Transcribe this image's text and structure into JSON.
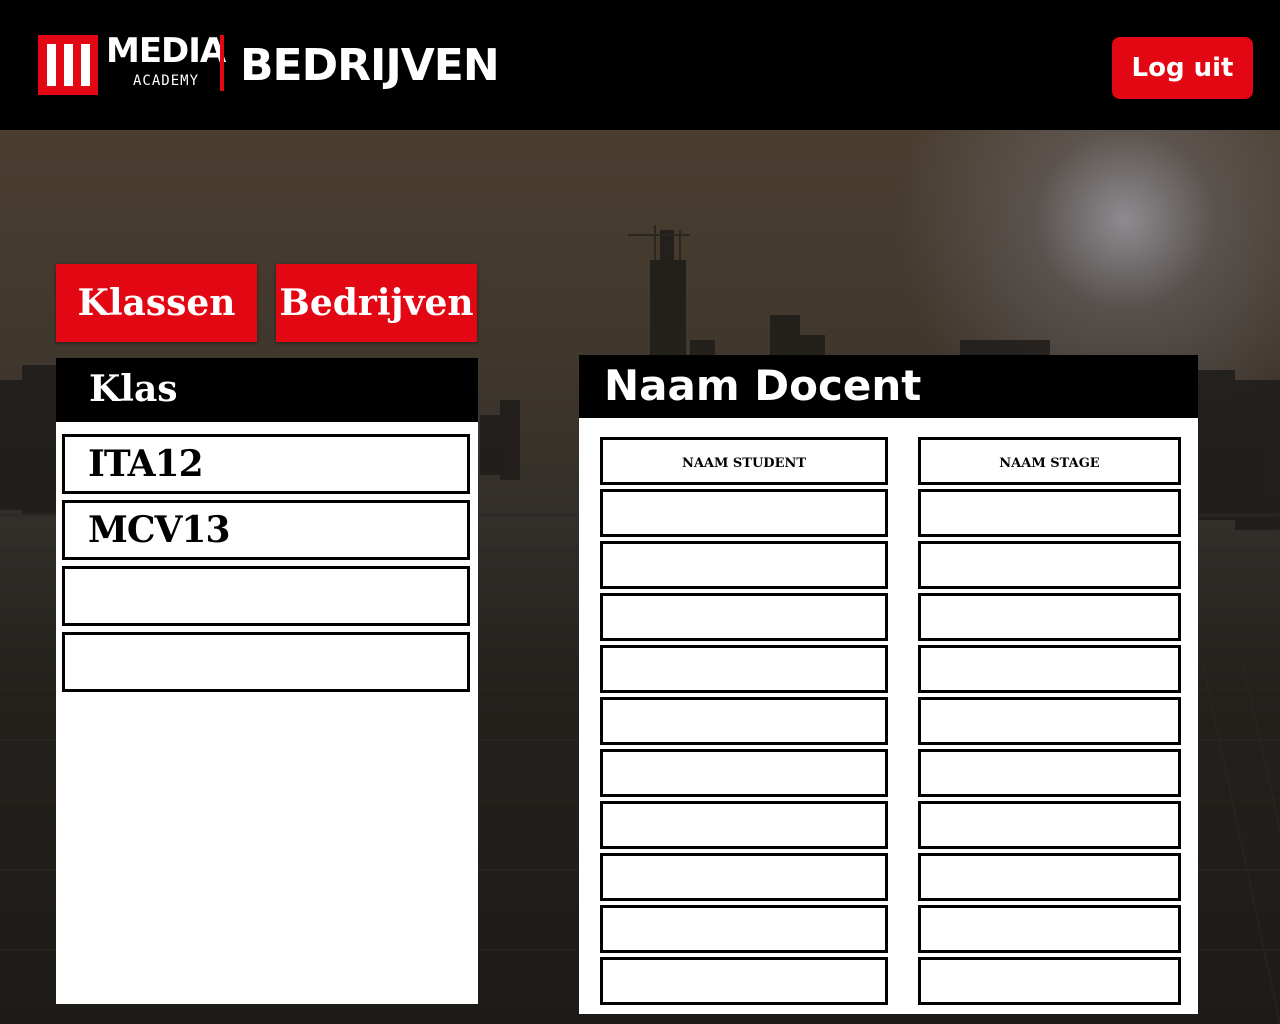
{
  "header": {
    "logo_text": "MEDIA",
    "logo_subtext": "ACADEMY",
    "page_title": "BEDRIJVEN",
    "logout_label": "Log uit"
  },
  "nav": {
    "klassen_label": "Klassen",
    "bedrijven_label": "Bedrijven"
  },
  "left_panel": {
    "title": "Klas",
    "items": [
      {
        "label": "ITA12"
      },
      {
        "label": "MCV13"
      },
      {
        "label": ""
      },
      {
        "label": ""
      }
    ]
  },
  "right_panel": {
    "title": "Naam Docent",
    "student_header": "NAAM STUDENT",
    "stage_header": "NAAM STAGE",
    "rows": [
      "",
      "",
      "",
      "",
      "",
      "",
      "",
      "",
      "",
      ""
    ]
  },
  "colors": {
    "accent": "#e30613",
    "header_bg": "#000000"
  }
}
